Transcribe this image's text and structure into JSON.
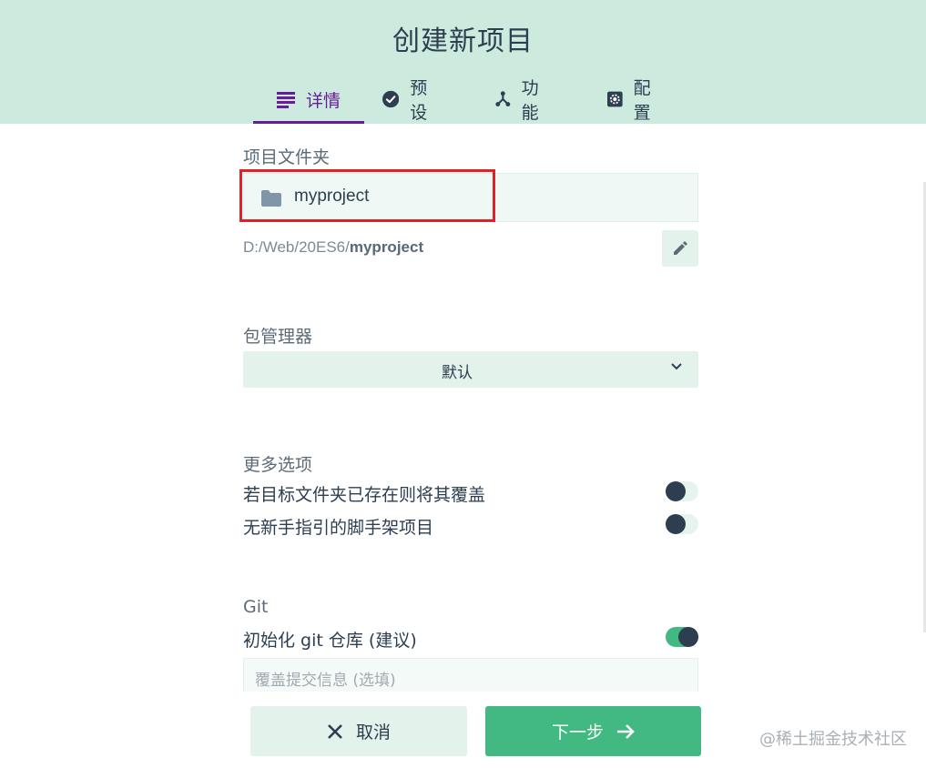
{
  "header": {
    "title": "创建新项目",
    "tabs": [
      {
        "label": "详情",
        "icon": "list-icon",
        "active": true
      },
      {
        "label": "预设",
        "icon": "check-circle-icon",
        "active": false
      },
      {
        "label": "功能",
        "icon": "fork-icon",
        "active": false
      },
      {
        "label": "配置",
        "icon": "gear-icon",
        "active": false
      }
    ]
  },
  "folder": {
    "label": "项目文件夹",
    "value": "myproject",
    "path_prefix": "D:/Web/20ES6/",
    "path_name": "myproject"
  },
  "package_manager": {
    "label": "包管理器",
    "selected": "默认"
  },
  "more_options": {
    "label": "更多选项",
    "items": [
      {
        "label": "若目标文件夹已存在则将其覆盖",
        "enabled": false
      },
      {
        "label": "无新手指引的脚手架项目",
        "enabled": false
      }
    ]
  },
  "git": {
    "label": "Git",
    "init_label": "初始化 git 仓库 (建议)",
    "init_enabled": true,
    "commit_placeholder": "覆盖提交信息 (选填)"
  },
  "footer": {
    "cancel_label": "取消",
    "next_label": "下一步"
  },
  "watermark": "@稀土掘金技术社区",
  "colors": {
    "header_bg": "#cceadd",
    "accent_purple": "#6a1b9a",
    "primary_green": "#42b983",
    "text_dark": "#2c3e50",
    "highlight_red": "#e02127"
  }
}
